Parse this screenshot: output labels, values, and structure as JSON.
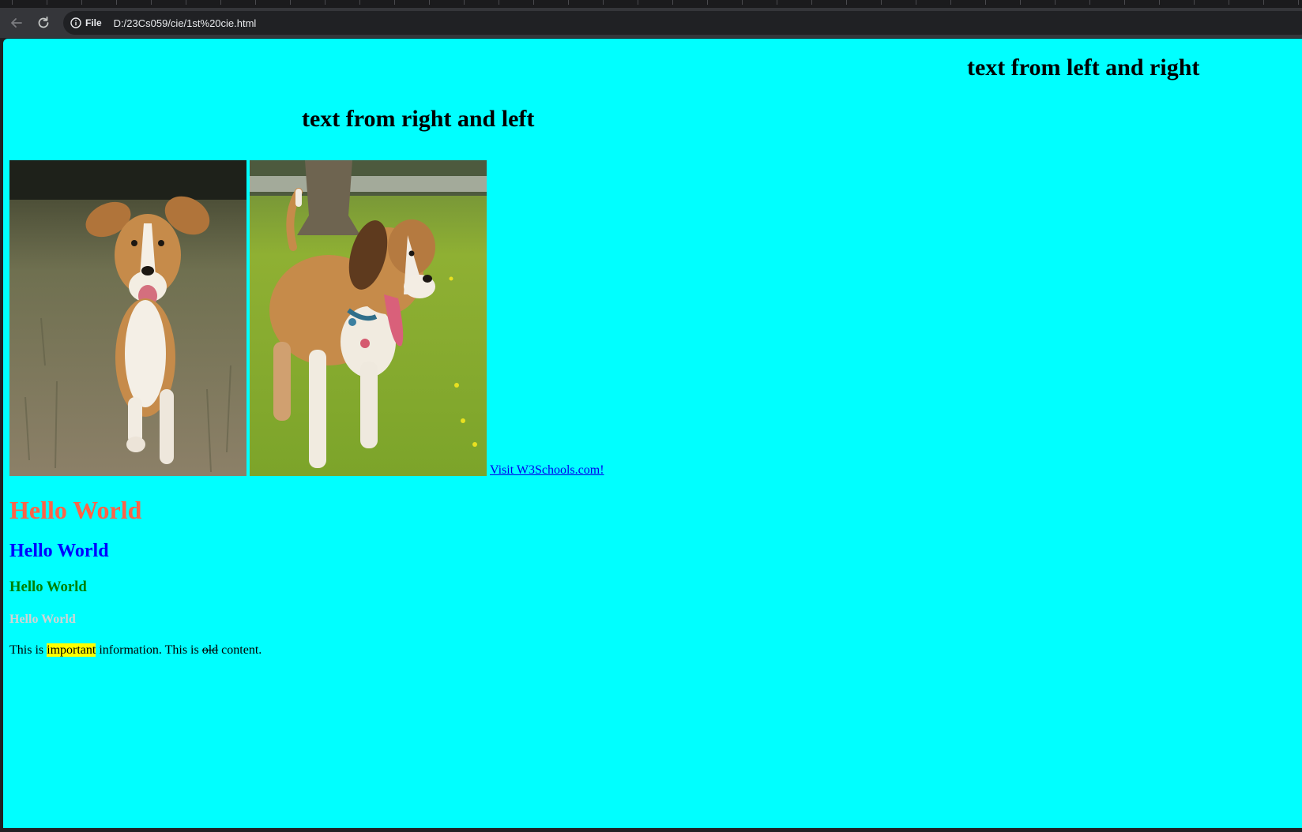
{
  "browser": {
    "scheme_label": "File",
    "url": "D:/23Cs059/cie/1st%20cie.html",
    "back_icon": "arrow-left-icon",
    "reload_icon": "reload-icon",
    "info_icon": "info-icon"
  },
  "page": {
    "background": "#00ffff",
    "heading_right": "text from left and right",
    "heading_center": "text from right and left",
    "images": [
      {
        "description_icon": "running-dog-photo"
      },
      {
        "description_icon": "walking-dog-photo"
      }
    ],
    "link_text": "Visit W3Schools.com!",
    "hello_1": {
      "text": "Hello World",
      "color": "#ff6347"
    },
    "hello_2": {
      "text": "Hello World",
      "color": "#0000ff"
    },
    "hello_3": {
      "text": "Hello World",
      "color": "#008000"
    },
    "hello_4": {
      "text": "Hello World",
      "color": "#d3d3d3"
    },
    "paragraph": {
      "part1": "This is ",
      "marked": "important",
      "part2": " information. This is ",
      "deleted": "old",
      "part3": " content."
    }
  }
}
